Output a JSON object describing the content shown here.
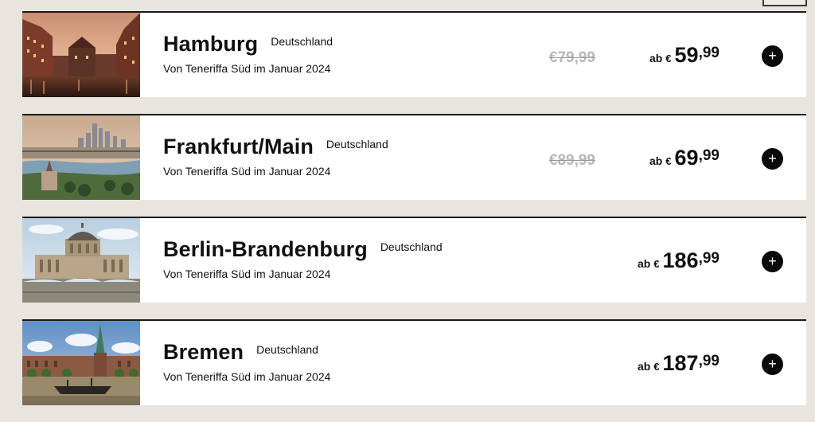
{
  "flights": [
    {
      "city": "Hamburg",
      "country": "Deutschland",
      "subtitle": "Von Teneriffa Süd im Januar 2024",
      "old_price": "€79,99",
      "price_prefix": "ab",
      "currency": "€",
      "price_int": "59",
      "price_dec": ",99",
      "add_icon": "plus-icon"
    },
    {
      "city": "Frankfurt/Main",
      "country": "Deutschland",
      "subtitle": "Von Teneriffa Süd im Januar 2024",
      "old_price": "€89,99",
      "price_prefix": "ab",
      "currency": "€",
      "price_int": "69",
      "price_dec": ",99",
      "add_icon": "plus-icon"
    },
    {
      "city": "Berlin-Brandenburg",
      "country": "Deutschland",
      "subtitle": "Von Teneriffa Süd im Januar 2024",
      "price_prefix": "ab",
      "currency": "€",
      "price_int": "186",
      "price_dec": ",99",
      "add_icon": "plus-icon"
    },
    {
      "city": "Bremen",
      "country": "Deutschland",
      "subtitle": "Von Teneriffa Süd im Januar 2024",
      "price_prefix": "ab",
      "currency": "€",
      "price_int": "187",
      "price_dec": ",99",
      "add_icon": "plus-icon"
    }
  ],
  "colors": {
    "page_background": "#e8e4de",
    "card_background": "#ffffff",
    "card_border": "#1a1a1a",
    "strike_price": "#b8b8b8",
    "button": "#0a0a0a"
  }
}
